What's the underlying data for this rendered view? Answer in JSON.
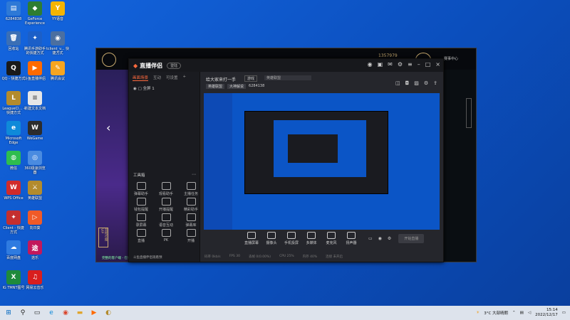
{
  "desktop_icons": [
    {
      "label": "6284838",
      "glyph": "▤",
      "color": "#2e79d6"
    },
    {
      "label": "GeForce Experience",
      "glyph": "◆",
      "color": "#2e7d32"
    },
    {
      "label": "YY语音",
      "glyph": "Y",
      "color": "#f5b400"
    },
    {
      "label": "回收站",
      "glyph": "🗑",
      "color": "#3b6fb5"
    },
    {
      "label": "腾讯手游助手的快捷方式",
      "glyph": "✦",
      "color": "#1b5fc8"
    },
    {
      "label": "tclient_v... 快捷方式",
      "glyph": "◉",
      "color": "#4b6fa0"
    },
    {
      "label": "QQ - 快捷方式",
      "glyph": "Q",
      "color": "#1a1a1a"
    },
    {
      "label": "斗鱼直播伴侣",
      "glyph": "▶",
      "color": "#ff6a00"
    },
    {
      "label": "腾讯会议",
      "glyph": "✎",
      "color": "#f7a520"
    },
    {
      "label": "LeagueCl... - 快捷方式",
      "glyph": "L",
      "color": "#b38b2d"
    },
    {
      "label": "新建文本文档",
      "glyph": "≡",
      "color": "#e6e6e6"
    },
    {
      "label": "Microsoft Edge",
      "glyph": "e",
      "color": "#0f8ad9"
    },
    {
      "label": "WeGame",
      "glyph": "W",
      "color": "#2c2c2c"
    },
    {
      "label": "微信",
      "glyph": "◍",
      "color": "#2ebd4e"
    },
    {
      "label": "360极速浏览器",
      "glyph": "◎",
      "color": "#4a8be0"
    },
    {
      "label": "WPS Office",
      "glyph": "W",
      "color": "#d12b2b"
    },
    {
      "label": "英雄联盟",
      "glyph": "⚔",
      "color": "#b38b2d"
    },
    {
      "label": "Client - 快捷方式",
      "glyph": "✦",
      "color": "#c42f2f"
    },
    {
      "label": "向日葵",
      "glyph": "▷",
      "color": "#f05a28"
    },
    {
      "label": "百度网盘",
      "glyph": "☁",
      "color": "#2f7be0"
    },
    {
      "label": "途乐",
      "glyph": "途",
      "color": "#c2185b"
    },
    {
      "label": "IG TMNT图号",
      "glyph": "X",
      "color": "#1e8a3c"
    },
    {
      "label": "网易云音乐",
      "glyph": "♫",
      "color": "#d81e1e"
    }
  ],
  "game": {
    "home_label": "首页",
    "points": "1357979",
    "side_label": "游戏仓库 VIP",
    "right_label": "赛事中心",
    "footer": "完整的客户端 - 在线"
  },
  "app": {
    "logo": "直播伴侣",
    "badge": "登陆",
    "tabs": [
      "画面场景",
      "互动",
      "可设置"
    ],
    "scene": "全屏 1",
    "stream_title": "给大家来打一手",
    "category": "游戏",
    "search_placeholder": "英雄联盟",
    "tag1": "英雄联盟",
    "tag2": "大神解说",
    "room_id": "6284138",
    "tools_title": "工具箱",
    "tools": [
      "弹幕助手",
      "观看助手",
      "主播任务",
      "钱包提醒",
      "开播提醒",
      "精彩助手",
      "录屏幕",
      "语音互动",
      "弹幕库",
      "直播",
      "PK",
      "开播"
    ],
    "bottom_buttons": [
      "直播屏幕",
      "摄像头",
      "手机投屏",
      "多媒体",
      "麦克风",
      "扬声器"
    ],
    "start_label": "开始直播",
    "bottom_note": "斗鱼直播伴侣观看预",
    "status": [
      "码率 0kb/s",
      "FPS 30",
      "丢帧 0(0.00%)",
      "CPU 25%",
      "内存 40%",
      "连接 未开启"
    ]
  },
  "taskbar": {
    "weather": "3°C 大部晴朗",
    "time": "15:14",
    "date": "2022/12/17"
  }
}
